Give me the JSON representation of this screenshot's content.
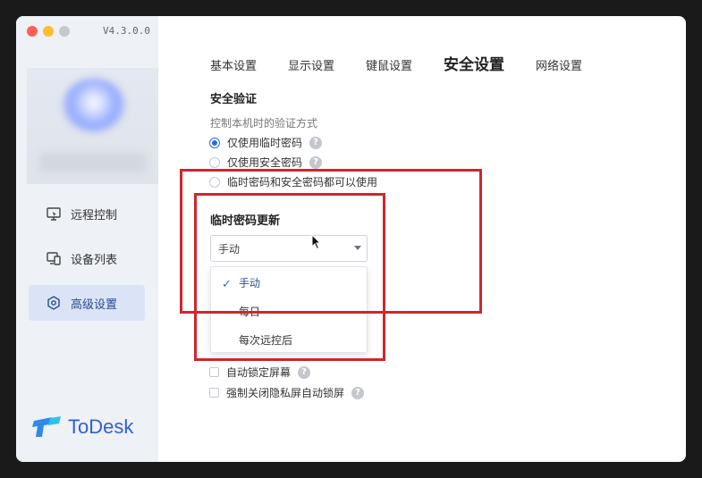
{
  "app": {
    "version": "V4.3.0.0",
    "logo_text": "ToDesk"
  },
  "sidebar": {
    "items": [
      {
        "label": "远程控制",
        "icon": "monitor-icon",
        "active": false
      },
      {
        "label": "设备列表",
        "icon": "devices-icon",
        "active": false
      },
      {
        "label": "高级设置",
        "icon": "hexagon-settings-icon",
        "active": true
      }
    ]
  },
  "tabs": [
    {
      "label": "基本设置",
      "active": false
    },
    {
      "label": "显示设置",
      "active": false
    },
    {
      "label": "键鼠设置",
      "active": false
    },
    {
      "label": "安全设置",
      "active": true
    },
    {
      "label": "网络设置",
      "active": false
    }
  ],
  "security": {
    "title": "安全验证",
    "desc": "控制本机时的验证方式",
    "options": [
      {
        "label": "仅使用临时密码",
        "checked": true,
        "help": true
      },
      {
        "label": "仅使用安全密码",
        "checked": false,
        "help": true
      },
      {
        "label": "临时密码和安全密码都可以使用",
        "checked": false,
        "help": false
      }
    ]
  },
  "temp_password": {
    "title": "临时密码更新",
    "selected": "手动",
    "options": [
      "手动",
      "每日",
      "每次远控后"
    ]
  },
  "privacy": {
    "items": [
      {
        "label": "自动锁定屏幕",
        "checked": false
      },
      {
        "label": "强制关闭隐私屏自动锁屏",
        "checked": false
      }
    ]
  },
  "colors": {
    "accent": "#2f6bd8",
    "highlight": "#d0262c",
    "sidebar_bg": "#eef1f6"
  }
}
